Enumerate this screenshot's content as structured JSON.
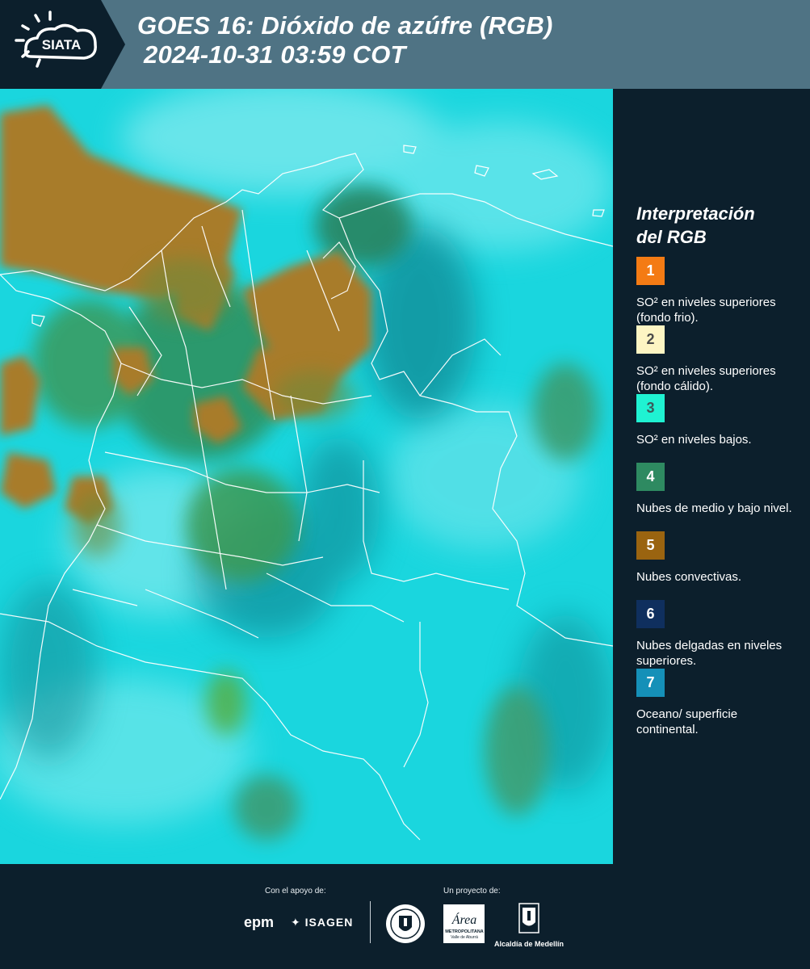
{
  "header": {
    "logo_text": "SIATA",
    "title_line1": "GOES 16: Dióxido de azúfre (RGB)",
    "title_line2": "2024-10-31 03:59 COT"
  },
  "legend": {
    "title_line1": "Interpretación",
    "title_line2": "del RGB",
    "items": [
      {
        "number": "1",
        "color": "#f47b14",
        "number_color": "#ffffff",
        "text": "SO² en niveles superiores (fondo frio)."
      },
      {
        "number": "2",
        "color": "#fdf5c3",
        "number_color": "#4a4a4a",
        "text": "SO² en niveles superiores (fondo cálido)."
      },
      {
        "number": "3",
        "color": "#1ff2d2",
        "number_color": "#3c5a5a",
        "text": "SO² en niveles bajos."
      },
      {
        "number": "4",
        "color": "#2e8a61",
        "number_color": "#ffffff",
        "text": "Nubes de medio y bajo nivel."
      },
      {
        "number": "5",
        "color": "#9a6410",
        "number_color": "#ffffff",
        "text": "Nubes convectivas."
      },
      {
        "number": "6",
        "color": "#0f2f5e",
        "number_color": "#ffffff",
        "text": "Nubes delgadas en niveles superiores."
      },
      {
        "number": "7",
        "color": "#1590b8",
        "number_color": "#ffffff",
        "text": "Oceano/ superficie continental."
      }
    ]
  },
  "footer": {
    "support_label": "Con el apoyo de:",
    "project_label": "Un proyecto de:",
    "sponsor1": "epm",
    "sponsor2": "ISAGEN",
    "partner_area": "Área",
    "partner_area_sub": "METROPOLITANA",
    "partner_area_sub2": "Valle de Aburrá",
    "partner_alcaldia": "Alcaldía de Medellín"
  },
  "map": {
    "ocean_color": "#18d8e0",
    "convective_color": "#a57b2e",
    "midcloud_color": "#2e8a55"
  }
}
